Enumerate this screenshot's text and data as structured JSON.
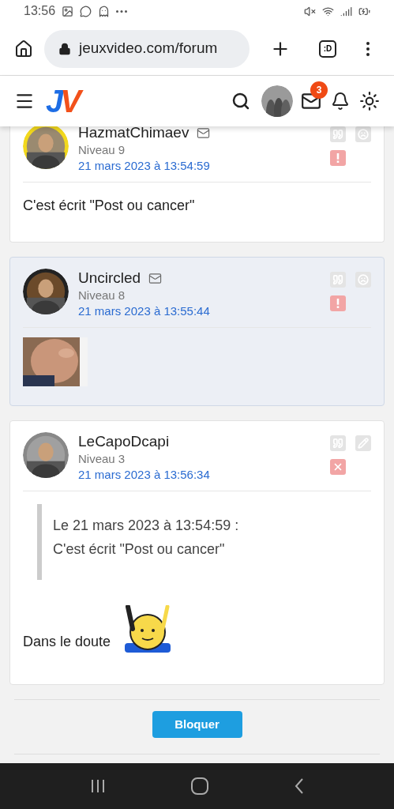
{
  "status_bar": {
    "time": "13:56"
  },
  "browser": {
    "url": "jeuxvideo.com/forum",
    "tab_label": ":D"
  },
  "header": {
    "logo": [
      {
        "char": "J",
        "color": "#1d6de5"
      },
      {
        "char": "V",
        "color": "#f2511b"
      }
    ],
    "mail_badge": "3"
  },
  "posts": [
    {
      "author": "HazmatChimaev",
      "mail": true,
      "level": "Niveau 9",
      "date": "21 mars 2023 à 13:54:59",
      "highlighted": false,
      "cut_top": true,
      "actions": [
        {
          "kind": "quote"
        },
        {
          "kind": "sad"
        },
        {
          "kind": "alert"
        }
      ],
      "body": [
        {
          "kind": "text",
          "text": "C'est écrit \"Post ou cancer\""
        }
      ]
    },
    {
      "author": "Uncircled",
      "mail": true,
      "level": "Niveau 8",
      "date": "21 mars 2023 à 13:55:44",
      "highlighted": true,
      "cut_top": false,
      "actions": [
        {
          "kind": "quote"
        },
        {
          "kind": "sad"
        },
        {
          "kind": "alert"
        }
      ]
    },
    {
      "author": "LeCapoDcapi",
      "mail": false,
      "level": "Niveau 3",
      "date": "21 mars 2023 à 13:56:34",
      "highlighted": false,
      "cut_top": false,
      "actions": [
        {
          "kind": "quote"
        },
        {
          "kind": "edit"
        },
        {
          "kind": "delete"
        }
      ],
      "body": [
        {
          "kind": "quote",
          "lines": [
            "Le 21 mars 2023 à 13:54:59 :",
            "C'est écrit \"Post ou cancer\""
          ]
        },
        {
          "kind": "sticker_text",
          "text": "Dans le doute"
        }
      ]
    }
  ],
  "block_button": "Bloquer"
}
